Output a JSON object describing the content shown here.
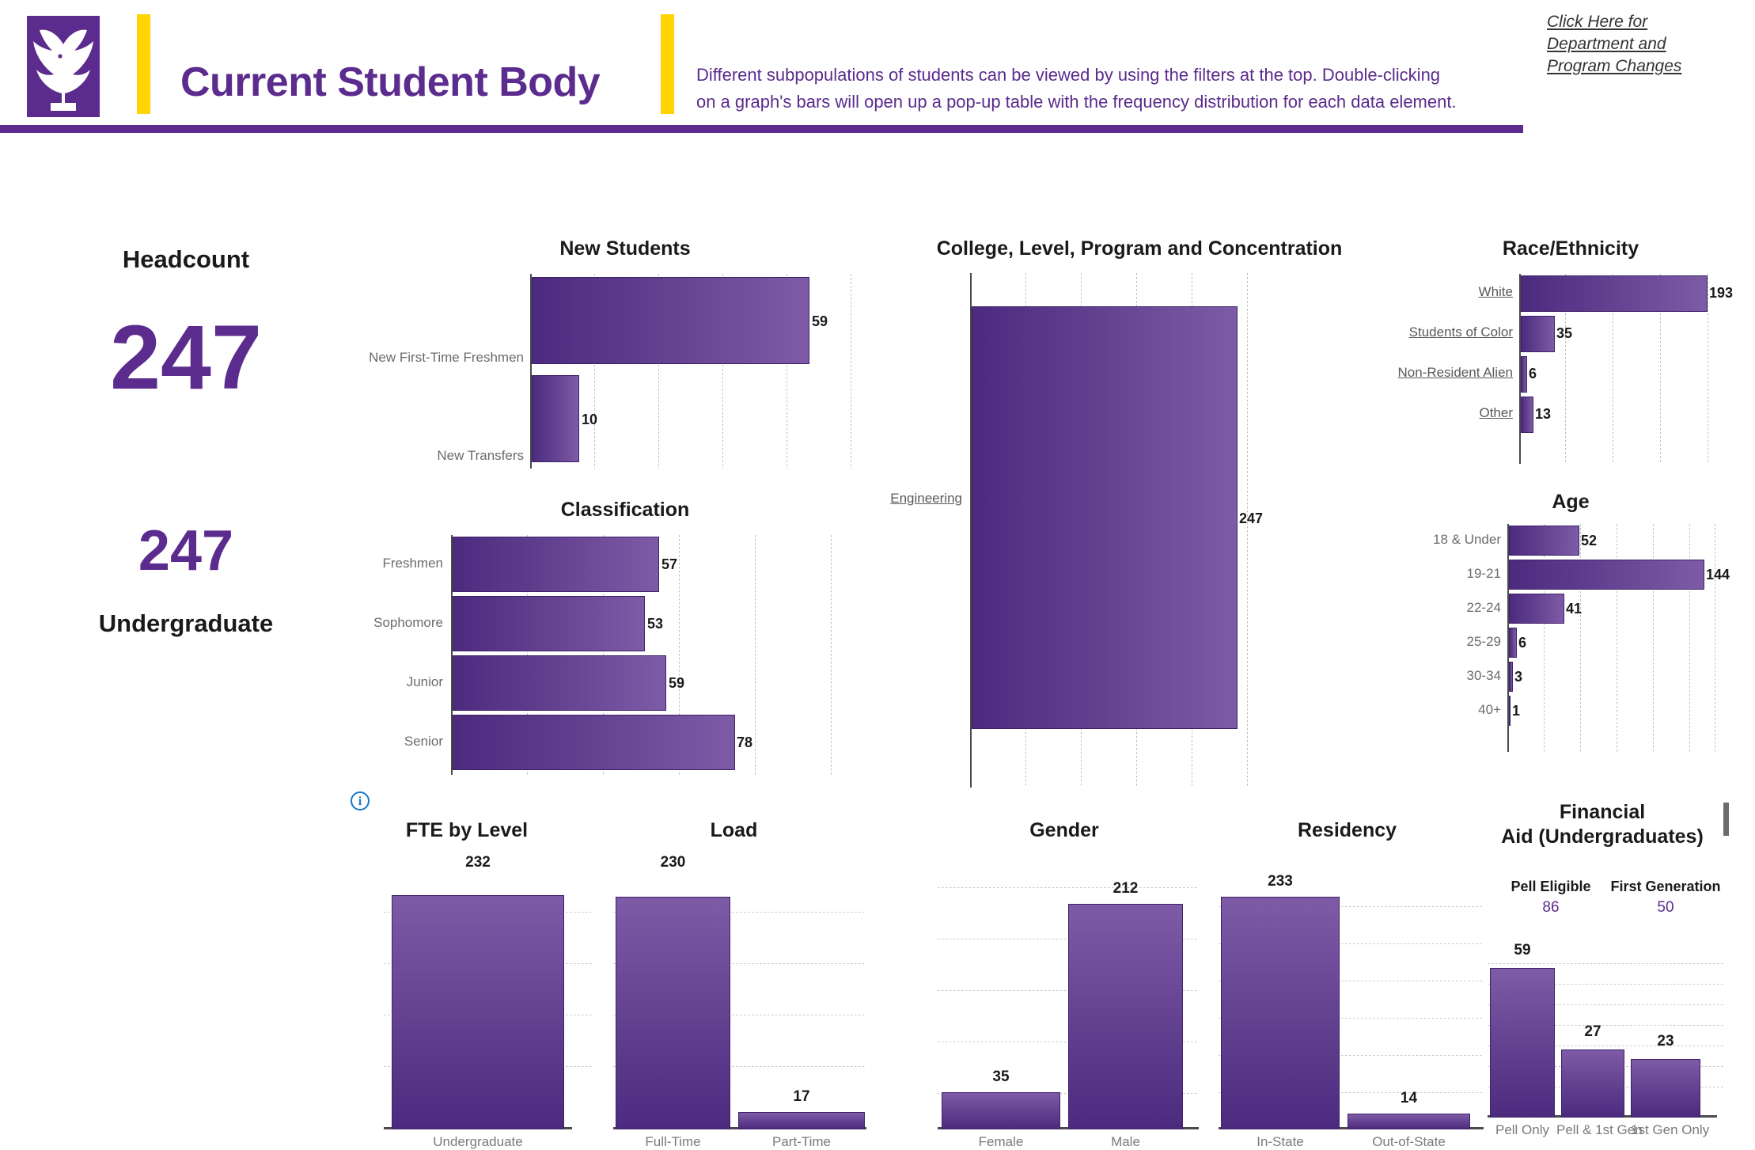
{
  "header": {
    "title": "Current Student Body",
    "description_line1": "Different subpopulations of students can be viewed by using the  filters at the top. Double-clicking",
    "description_line2": "on a graph's bars will open up a pop-up table with the frequency distribution for each data element.",
    "link_line1": "Click Here for",
    "link_line2": "Department and",
    "link_line3": "Program Changes",
    "logo_name": "eagle-logo",
    "brand_purple": "#5B2B8D",
    "brand_gold": "#FFD400"
  },
  "kpi": {
    "title": "Headcount",
    "total": "247",
    "undergraduate_value": "247",
    "undergraduate_label": "Undergraduate"
  },
  "info_icon": {
    "glyph": "i"
  },
  "chart_data": [
    {
      "id": "new_students",
      "type": "bar",
      "orientation": "horizontal",
      "title": "New Students",
      "categories": [
        "New First-Time Freshmen",
        "New Transfers"
      ],
      "values": [
        59,
        10
      ],
      "labels": [
        "59",
        "10"
      ],
      "xlabel": "",
      "ylabel": "",
      "xlim": [
        0,
        70
      ],
      "grid": true,
      "legend": "none"
    },
    {
      "id": "classification",
      "type": "bar",
      "orientation": "horizontal",
      "title": "Classification",
      "categories": [
        "Freshmen",
        "Sophomore",
        "Junior",
        "Senior"
      ],
      "values": [
        57,
        53,
        59,
        78
      ],
      "labels": [
        "57",
        "53",
        "59",
        "78"
      ],
      "xlabel": "",
      "ylabel": "",
      "xlim": [
        0,
        82
      ],
      "grid": true,
      "legend": "none"
    },
    {
      "id": "college_level_program",
      "type": "bar",
      "orientation": "horizontal",
      "title": "College, Level, Program and Concentration",
      "categories": [
        "Engineering"
      ],
      "values": [
        247
      ],
      "labels": [
        "247"
      ],
      "xlabel": "",
      "ylabel": "",
      "xlim": [
        0,
        260
      ],
      "grid": true,
      "legend": "none"
    },
    {
      "id": "race_ethnicity",
      "type": "bar",
      "orientation": "horizontal",
      "title": "Race/Ethnicity",
      "categories": [
        "White",
        "Students of Color",
        "Non-Resident Alien",
        "Other"
      ],
      "values": [
        193,
        35,
        6,
        13
      ],
      "labels": [
        "193",
        "35",
        "6",
        "13"
      ],
      "xlabel": "",
      "ylabel": "",
      "xlim": [
        0,
        205
      ],
      "grid": true,
      "legend": "none"
    },
    {
      "id": "age",
      "type": "bar",
      "orientation": "horizontal",
      "title": "Age",
      "categories": [
        "18 & Under",
        "19-21",
        "22-24",
        "25-29",
        "30-34",
        "40+"
      ],
      "values": [
        52,
        144,
        41,
        6,
        3,
        1
      ],
      "labels": [
        "52",
        "144",
        "41",
        "6",
        "3",
        "1"
      ],
      "xlabel": "",
      "ylabel": "",
      "xlim": [
        0,
        160
      ],
      "grid": true,
      "legend": "none"
    },
    {
      "id": "fte_by_level",
      "type": "bar",
      "orientation": "vertical",
      "title": "FTE by Level",
      "categories": [
        "Undergraduate"
      ],
      "values": [
        232
      ],
      "labels": [
        "232"
      ],
      "xlabel": "",
      "ylabel": "",
      "ylim": [
        0,
        240
      ],
      "grid": true,
      "legend": "none"
    },
    {
      "id": "load",
      "type": "bar",
      "orientation": "vertical",
      "title": "Load",
      "categories": [
        "Full-Time",
        "Part-Time"
      ],
      "values": [
        230,
        17
      ],
      "labels": [
        "230",
        "17"
      ],
      "xlabel": "",
      "ylabel": "",
      "ylim": [
        0,
        240
      ],
      "grid": true,
      "legend": "none"
    },
    {
      "id": "gender",
      "type": "bar",
      "orientation": "vertical",
      "title": "Gender",
      "categories": [
        "Female",
        "Male"
      ],
      "values": [
        35,
        212
      ],
      "labels": [
        "35",
        "212"
      ],
      "xlabel": "",
      "ylabel": "",
      "ylim": [
        0,
        225
      ],
      "grid": true,
      "legend": "none"
    },
    {
      "id": "residency",
      "type": "bar",
      "orientation": "vertical",
      "title": "Residency",
      "categories": [
        "In-State",
        "Out-of-State"
      ],
      "values": [
        233,
        14
      ],
      "labels": [
        "233",
        "14"
      ],
      "xlabel": "",
      "ylabel": "",
      "ylim": [
        0,
        245
      ],
      "grid": true,
      "legend": "none"
    },
    {
      "id": "financial_aid",
      "type": "bar",
      "orientation": "vertical",
      "title_line1": "Financial",
      "title_line2": "Aid (Undergraduates)",
      "title": "Financial Aid (Undergraduates)",
      "categories": [
        "Pell Only",
        "Pell & 1st Gen",
        "1st Gen Only"
      ],
      "values": [
        59,
        27,
        23
      ],
      "labels": [
        "59",
        "27",
        "23"
      ],
      "xlabel": "",
      "ylabel": "",
      "ylim": [
        0,
        62
      ],
      "grid": true,
      "legend": "none",
      "summary": [
        {
          "label": "Pell Eligible",
          "value": "86"
        },
        {
          "label": "First Generation",
          "value": "50"
        }
      ]
    }
  ]
}
